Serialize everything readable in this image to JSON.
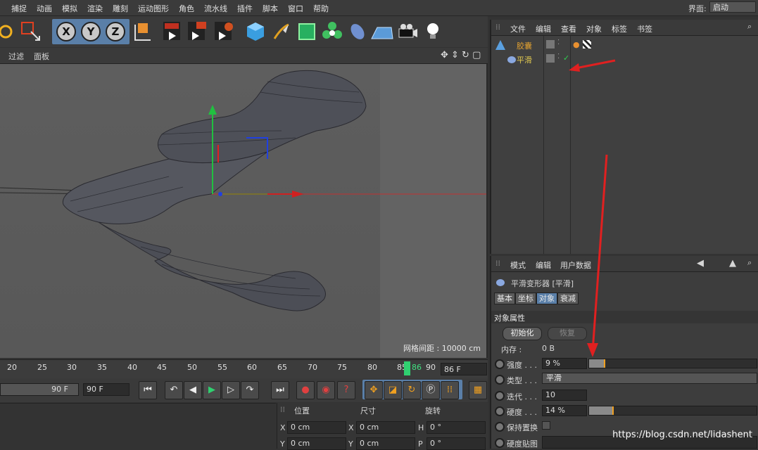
{
  "menu": [
    "捕捉",
    "动画",
    "模拟",
    "渲染",
    "雕刻",
    "运动图形",
    "角色",
    "流水线",
    "插件",
    "脚本",
    "窗口",
    "帮助"
  ],
  "layout": {
    "label": "界面:",
    "value": "启动"
  },
  "viewport": {
    "menu": [
      "过滤",
      "面板"
    ],
    "grid_info": "网格间距 : 10000 cm"
  },
  "timeline": {
    "ticks": [
      "20",
      "25",
      "30",
      "35",
      "40",
      "45",
      "50",
      "55",
      "60",
      "65",
      "70",
      "75",
      "80",
      "85",
      "90"
    ],
    "current_tick": "86",
    "frame_field": "86 F"
  },
  "transport": {
    "start_frame": "90 F",
    "end_frame": "90 F"
  },
  "coords": {
    "headers": [
      "位置",
      "尺寸",
      "旋转"
    ],
    "rows": [
      {
        "a_label": "X",
        "a": "0 cm",
        "b_label": "X",
        "b": "0 cm",
        "c_label": "H",
        "c": "0 °"
      },
      {
        "a_label": "Y",
        "a": "0 cm",
        "b_label": "Y",
        "b": "0 cm",
        "c_label": "P",
        "c": "0 °"
      }
    ]
  },
  "object_manager": {
    "tabs": [
      "文件",
      "编辑",
      "查看",
      "对象",
      "标签",
      "书签"
    ],
    "objects": [
      {
        "name": "胶囊",
        "color": "#e0a030"
      },
      {
        "name": "平滑",
        "color": "#e0c850"
      }
    ]
  },
  "attributes": {
    "tabs": [
      "模式",
      "编辑",
      "用户数据"
    ],
    "title": "平滑变形器 [平滑]",
    "subtabs": [
      "基本",
      "坐标",
      "对象",
      "衰减"
    ],
    "active_subtab": "对象",
    "section": "对象属性",
    "init_button": "初始化",
    "restore_button": "恢复",
    "memory_label": "内存 :",
    "memory_value": "0 B",
    "rows": [
      {
        "label": "强度 . . .",
        "value": "9 %",
        "fill": 0.09
      },
      {
        "label": "类型 . . .",
        "value": "平滑"
      },
      {
        "label": "迭代 . . .",
        "value": "10"
      },
      {
        "label": "硬度 . . .",
        "value": "14 %",
        "fill": 0.14
      },
      {
        "label": "保持置换"
      },
      {
        "label": "硬度贴图"
      }
    ]
  },
  "watermark": "https://blog.csdn.net/lidashent"
}
